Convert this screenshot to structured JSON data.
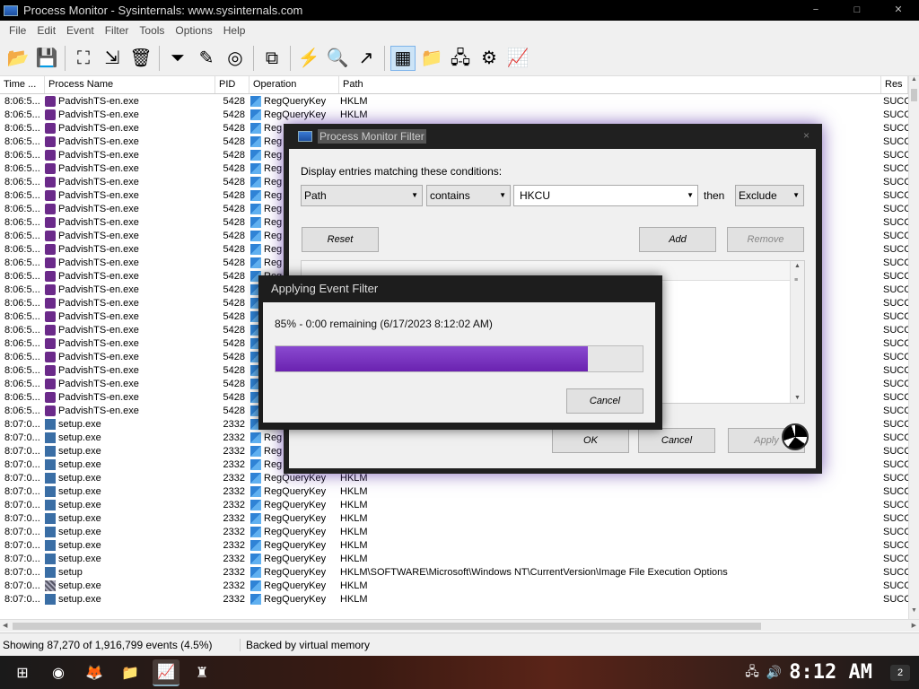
{
  "window": {
    "title": "Process Monitor - Sysinternals: www.sysinternals.com",
    "min": "−",
    "max": "□",
    "close": "✕"
  },
  "menu": [
    "File",
    "Edit",
    "Event",
    "Filter",
    "Tools",
    "Options",
    "Help"
  ],
  "toolbar": [
    {
      "name": "open-icon",
      "glyph": "📂"
    },
    {
      "name": "save-icon",
      "glyph": "💾"
    },
    {
      "sep": true
    },
    {
      "name": "capture-icon",
      "glyph": "⛶"
    },
    {
      "name": "autoscroll-icon",
      "glyph": "⇲"
    },
    {
      "name": "clear-icon",
      "glyph": "🗑"
    },
    {
      "sep": true
    },
    {
      "name": "filter-icon",
      "glyph": "⏷"
    },
    {
      "name": "highlight-icon",
      "glyph": "✎"
    },
    {
      "name": "target-icon",
      "glyph": "◎"
    },
    {
      "sep": true
    },
    {
      "name": "process-tree-icon",
      "glyph": "⧉"
    },
    {
      "sep": true
    },
    {
      "name": "event-properties-icon",
      "glyph": "⚡"
    },
    {
      "name": "find-icon",
      "glyph": "🔍"
    },
    {
      "name": "jump-to-icon",
      "glyph": "↗"
    },
    {
      "sep": true
    },
    {
      "name": "registry-activity-icon",
      "glyph": "▦",
      "active": true
    },
    {
      "name": "filesystem-activity-icon",
      "glyph": "📁"
    },
    {
      "name": "network-activity-icon",
      "glyph": "🖧"
    },
    {
      "name": "process-activity-icon",
      "glyph": "⚙"
    },
    {
      "name": "profiling-activity-icon",
      "glyph": "📈"
    }
  ],
  "columns": {
    "time": "Time ...",
    "process": "Process Name",
    "pid": "PID",
    "operation": "Operation",
    "path": "Path",
    "result": "Res"
  },
  "rows": [
    {
      "time": "8:06:5...",
      "process": "PadvishTS-en.exe",
      "icon": "pad",
      "pid": "5428",
      "op": "RegQueryKey",
      "path": "HKLM",
      "result": "SUCC"
    },
    {
      "time": "8:06:5...",
      "process": "PadvishTS-en.exe",
      "icon": "pad",
      "pid": "5428",
      "op": "RegQueryKey",
      "path": "HKLM",
      "result": "SUCC"
    },
    {
      "time": "8:06:5...",
      "process": "PadvishTS-en.exe",
      "icon": "pad",
      "pid": "5428",
      "op": "Reg",
      "path": "",
      "result": "SUCC"
    },
    {
      "time": "8:06:5...",
      "process": "PadvishTS-en.exe",
      "icon": "pad",
      "pid": "5428",
      "op": "Reg",
      "path": "",
      "result": "SUCC"
    },
    {
      "time": "8:06:5...",
      "process": "PadvishTS-en.exe",
      "icon": "pad",
      "pid": "5428",
      "op": "Reg",
      "path": "",
      "result": "SUCC"
    },
    {
      "time": "8:06:5...",
      "process": "PadvishTS-en.exe",
      "icon": "pad",
      "pid": "5428",
      "op": "Reg",
      "path": "",
      "result": "SUCC"
    },
    {
      "time": "8:06:5...",
      "process": "PadvishTS-en.exe",
      "icon": "pad",
      "pid": "5428",
      "op": "Reg",
      "path": "",
      "result": "SUCC"
    },
    {
      "time": "8:06:5...",
      "process": "PadvishTS-en.exe",
      "icon": "pad",
      "pid": "5428",
      "op": "Reg",
      "path": "",
      "result": "SUCC"
    },
    {
      "time": "8:06:5...",
      "process": "PadvishTS-en.exe",
      "icon": "pad",
      "pid": "5428",
      "op": "Reg",
      "path": "",
      "result": "SUCC"
    },
    {
      "time": "8:06:5...",
      "process": "PadvishTS-en.exe",
      "icon": "pad",
      "pid": "5428",
      "op": "Reg",
      "path": "",
      "result": "SUCC"
    },
    {
      "time": "8:06:5...",
      "process": "PadvishTS-en.exe",
      "icon": "pad",
      "pid": "5428",
      "op": "Reg",
      "path": "",
      "result": "SUCC"
    },
    {
      "time": "8:06:5...",
      "process": "PadvishTS-en.exe",
      "icon": "pad",
      "pid": "5428",
      "op": "Reg",
      "path": "",
      "result": "SUCC"
    },
    {
      "time": "8:06:5...",
      "process": "PadvishTS-en.exe",
      "icon": "pad",
      "pid": "5428",
      "op": "Reg",
      "path": "",
      "result": "SUCC"
    },
    {
      "time": "8:06:5...",
      "process": "PadvishTS-en.exe",
      "icon": "pad",
      "pid": "5428",
      "op": "Reg",
      "path": "",
      "result": "SUCC"
    },
    {
      "time": "8:06:5...",
      "process": "PadvishTS-en.exe",
      "icon": "pad",
      "pid": "5428",
      "op": "Reg",
      "path": "",
      "result": "SUCC"
    },
    {
      "time": "8:06:5...",
      "process": "PadvishTS-en.exe",
      "icon": "pad",
      "pid": "5428",
      "op": "Reg",
      "path": "",
      "result": "SUCC"
    },
    {
      "time": "8:06:5...",
      "process": "PadvishTS-en.exe",
      "icon": "pad",
      "pid": "5428",
      "op": "Reg",
      "path": "",
      "result": "SUCC"
    },
    {
      "time": "8:06:5...",
      "process": "PadvishTS-en.exe",
      "icon": "pad",
      "pid": "5428",
      "op": "Reg",
      "path": "",
      "result": "SUCC"
    },
    {
      "time": "8:06:5...",
      "process": "PadvishTS-en.exe",
      "icon": "pad",
      "pid": "5428",
      "op": "Reg",
      "path": "",
      "result": "SUCC"
    },
    {
      "time": "8:06:5...",
      "process": "PadvishTS-en.exe",
      "icon": "pad",
      "pid": "5428",
      "op": "Reg",
      "path": "",
      "result": "SUCC"
    },
    {
      "time": "8:06:5...",
      "process": "PadvishTS-en.exe",
      "icon": "pad",
      "pid": "5428",
      "op": "Reg",
      "path": "",
      "result": "SUCC"
    },
    {
      "time": "8:06:5...",
      "process": "PadvishTS-en.exe",
      "icon": "pad",
      "pid": "5428",
      "op": "Reg",
      "path": "",
      "result": "SUCC"
    },
    {
      "time": "8:06:5...",
      "process": "PadvishTS-en.exe",
      "icon": "pad",
      "pid": "5428",
      "op": "Reg",
      "path": "",
      "result": "SUCC"
    },
    {
      "time": "8:06:5...",
      "process": "PadvishTS-en.exe",
      "icon": "pad",
      "pid": "5428",
      "op": "Reg",
      "path": "",
      "result": "SUCC"
    },
    {
      "time": "8:07:0...",
      "process": "setup.exe",
      "icon": "setup",
      "pid": "2332",
      "op": "Reg",
      "path": "",
      "result": "SUCC"
    },
    {
      "time": "8:07:0...",
      "process": "setup.exe",
      "icon": "setup",
      "pid": "2332",
      "op": "Reg",
      "path": "",
      "result": "SUCC"
    },
    {
      "time": "8:07:0...",
      "process": "setup.exe",
      "icon": "setup",
      "pid": "2332",
      "op": "Reg",
      "path": "",
      "result": "SUCC"
    },
    {
      "time": "8:07:0...",
      "process": "setup.exe",
      "icon": "setup",
      "pid": "2332",
      "op": "Reg",
      "path": "",
      "result": "SUCC"
    },
    {
      "time": "8:07:0...",
      "process": "setup.exe",
      "icon": "setup",
      "pid": "2332",
      "op": "RegQueryKey",
      "path": "HKLM",
      "result": "SUCC"
    },
    {
      "time": "8:07:0...",
      "process": "setup.exe",
      "icon": "setup",
      "pid": "2332",
      "op": "RegQueryKey",
      "path": "HKLM",
      "result": "SUCC"
    },
    {
      "time": "8:07:0...",
      "process": "setup.exe",
      "icon": "setup",
      "pid": "2332",
      "op": "RegQueryKey",
      "path": "HKLM",
      "result": "SUCC"
    },
    {
      "time": "8:07:0...",
      "process": "setup.exe",
      "icon": "setup",
      "pid": "2332",
      "op": "RegQueryKey",
      "path": "HKLM",
      "result": "SUCC"
    },
    {
      "time": "8:07:0...",
      "process": "setup.exe",
      "icon": "setup",
      "pid": "2332",
      "op": "RegQueryKey",
      "path": "HKLM",
      "result": "SUCC"
    },
    {
      "time": "8:07:0...",
      "process": "setup.exe",
      "icon": "setup",
      "pid": "2332",
      "op": "RegQueryKey",
      "path": "HKLM",
      "result": "SUCC"
    },
    {
      "time": "8:07:0...",
      "process": "setup.exe",
      "icon": "setup",
      "pid": "2332",
      "op": "RegQueryKey",
      "path": "HKLM",
      "result": "SUCC"
    },
    {
      "time": "8:07:0...",
      "process": "setup",
      "icon": "setup",
      "pid": "2332",
      "op": "RegQueryKey",
      "path": "HKLM\\SOFTWARE\\Microsoft\\Windows NT\\CurrentVersion\\Image File Execution Options",
      "result": "SUCC"
    },
    {
      "time": "8:07:0...",
      "process": "setup.exe",
      "icon": "setup2",
      "pid": "2332",
      "op": "RegQueryKey",
      "path": "HKLM",
      "result": "SUCC"
    },
    {
      "time": "8:07:0...",
      "process": "setup.exe",
      "icon": "setup",
      "pid": "2332",
      "op": "RegQueryKey",
      "path": "HKLM",
      "result": "SUCC"
    }
  ],
  "status": {
    "events": "Showing 87,270 of 1,916,799 events (4.5%)",
    "backing": "Backed by virtual memory"
  },
  "filter_dialog": {
    "title": "Process Monitor Filter",
    "close": "×",
    "caption": "Display entries matching these conditions:",
    "column_value": "Path",
    "relation_value": "contains",
    "value_text": "HKCU",
    "then_label": "then",
    "action_value": "Exclude",
    "reset": "Reset",
    "add": "Add",
    "remove": "Remove",
    "ok": "OK",
    "cancel": "Cancel",
    "apply": "Apply"
  },
  "progress_dialog": {
    "title": "Applying Event Filter",
    "text": "85% - 0:00 remaining (6/17/2023 8:12:02 AM)",
    "progress": 0.85,
    "cancel": "Cancel"
  },
  "taskbar": {
    "items": [
      {
        "name": "start-icon",
        "glyph": "⊞"
      },
      {
        "name": "chrome-icon",
        "glyph": "◉"
      },
      {
        "name": "firefox-icon",
        "glyph": "🦊"
      },
      {
        "name": "file-explorer-icon",
        "glyph": "📁"
      },
      {
        "name": "process-monitor-task-icon",
        "glyph": "📈",
        "active": true
      },
      {
        "name": "padvish-task-icon",
        "glyph": "♜"
      }
    ],
    "clock": "8:12 AM",
    "notifications": "2"
  }
}
